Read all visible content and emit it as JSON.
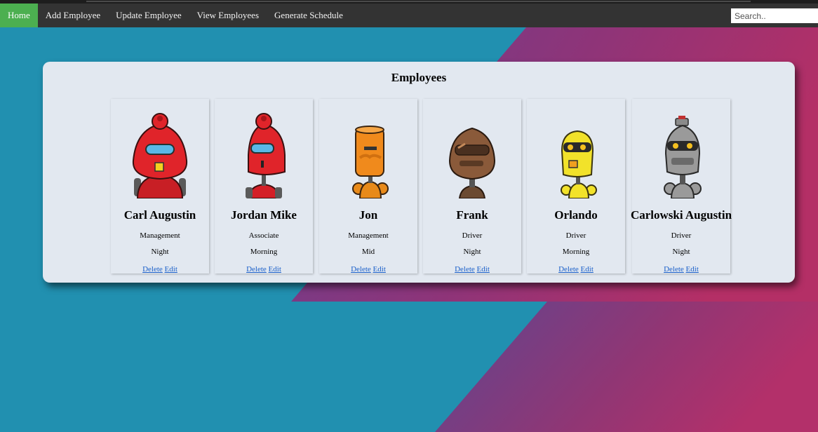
{
  "nav": {
    "items": [
      "Home",
      "Add Employee",
      "Update Employee",
      "View Employees",
      "Generate Schedule"
    ],
    "active": "Home",
    "search_placeholder": "Search.."
  },
  "panel": {
    "title": "Employees"
  },
  "employees": [
    {
      "name": "Carl Augustin",
      "role": "Management",
      "shift": "Night",
      "delete_label": "Delete",
      "edit_label": "Edit",
      "avatar_icon": "red-robot-icon",
      "avatar_color": "#e0242a"
    },
    {
      "name": "Jordan Mike",
      "role": "Associate",
      "shift": "Morning",
      "delete_label": "Delete",
      "edit_label": "Edit",
      "avatar_icon": "red-robot-icon",
      "avatar_color": "#e0242a"
    },
    {
      "name": "Jon",
      "role": "Management",
      "shift": "Mid",
      "delete_label": "Delete",
      "edit_label": "Edit",
      "avatar_icon": "orange-robot-icon",
      "avatar_color": "#f08a1c"
    },
    {
      "name": "Frank",
      "role": "Driver",
      "shift": "Night",
      "delete_label": "Delete",
      "edit_label": "Edit",
      "avatar_icon": "brown-robot-icon",
      "avatar_color": "#8a5a3a"
    },
    {
      "name": "Orlando",
      "role": "Driver",
      "shift": "Morning",
      "delete_label": "Delete",
      "edit_label": "Edit",
      "avatar_icon": "yellow-robot-icon",
      "avatar_color": "#f2e22a"
    },
    {
      "name": "Carlowski Augustin",
      "role": "Driver",
      "shift": "Night",
      "delete_label": "Delete",
      "edit_label": "Edit",
      "avatar_icon": "gray-robot-icon",
      "avatar_color": "#9a9a9a"
    }
  ],
  "colors": {
    "nav_bg": "#333333",
    "nav_active": "#4CAF50",
    "bg_teal": "#2190b0",
    "bg_purple": "#7b3c8c",
    "bg_magenta": "#b3306a",
    "panel_bg": "#e2e8f0",
    "link": "#1a5fc9"
  }
}
